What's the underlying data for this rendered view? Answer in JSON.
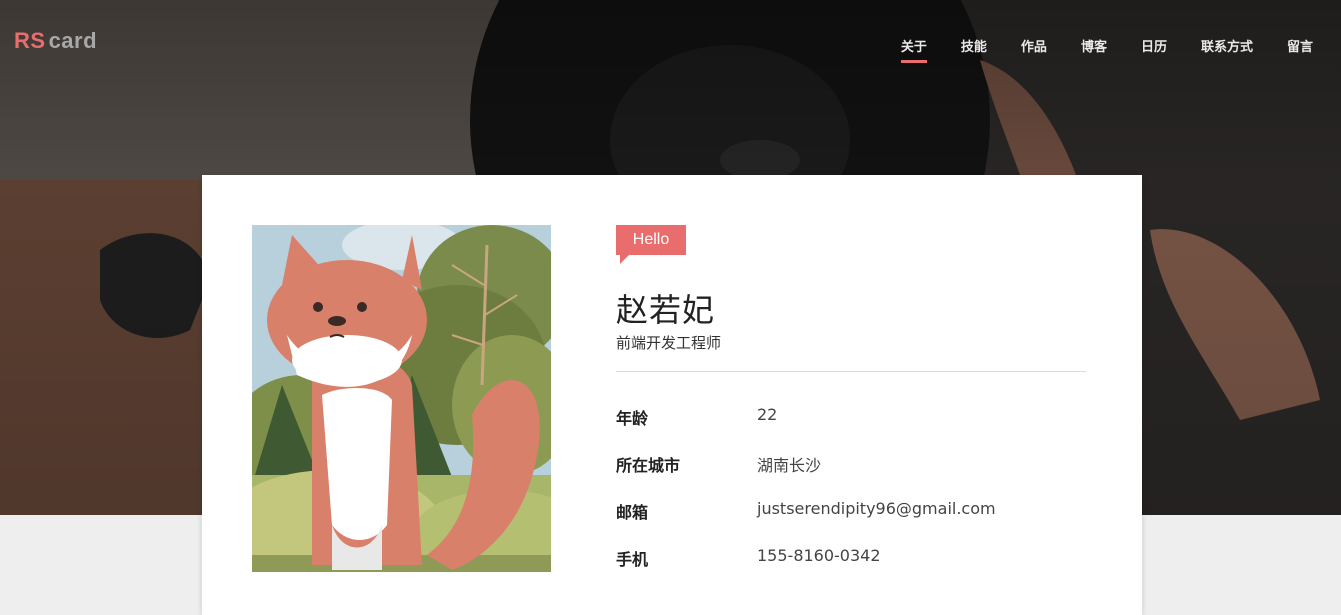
{
  "logo": {
    "part1": "RS",
    "part2": "card"
  },
  "nav": {
    "items": [
      {
        "label": "关于",
        "active": true
      },
      {
        "label": "技能"
      },
      {
        "label": "作品"
      },
      {
        "label": "博客"
      },
      {
        "label": "日历"
      },
      {
        "label": "联系方式"
      },
      {
        "label": "留言"
      }
    ]
  },
  "profile": {
    "greeting": "Hello",
    "name": "赵若妃",
    "title": "前端开发工程师",
    "avatar_icon": "fox-illustration",
    "info": [
      {
        "label": "年龄",
        "value": "22"
      },
      {
        "label": "所在城市",
        "value": "湖南长沙"
      },
      {
        "label": "邮箱",
        "value": "justserendipity96@gmail.com"
      },
      {
        "label": "手机",
        "value": "155-8160-0342"
      }
    ]
  },
  "colors": {
    "accent": "#e96d6d",
    "logo_gray": "#a7a7a7",
    "page_bg": "#eeeeee"
  }
}
